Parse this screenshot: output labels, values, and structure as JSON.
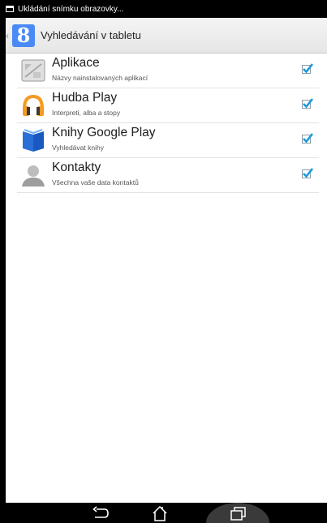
{
  "status": {
    "text": "Ukládání snímku obrazovky..."
  },
  "actionbar": {
    "title": "Vyhledávání v tabletu",
    "logo": "8"
  },
  "items": [
    {
      "title": "Aplikace",
      "sub": "Názvy nainstalovaných aplikací",
      "icon": "apps-icon",
      "checked": true
    },
    {
      "title": "Hudba Play",
      "sub": "Interpreti, alba a stopy",
      "icon": "headphones-icon",
      "checked": true
    },
    {
      "title": "Knihy Google Play",
      "sub": "Vyhledávat knihy",
      "icon": "book-icon",
      "checked": true
    },
    {
      "title": "Kontakty",
      "sub": "Všechna vaše data kontaktů",
      "icon": "contact-icon",
      "checked": true
    }
  ],
  "colors": {
    "accent": "#4a8af4",
    "checkmark": "#1e9bd7",
    "music_orange": "#f59a22"
  }
}
